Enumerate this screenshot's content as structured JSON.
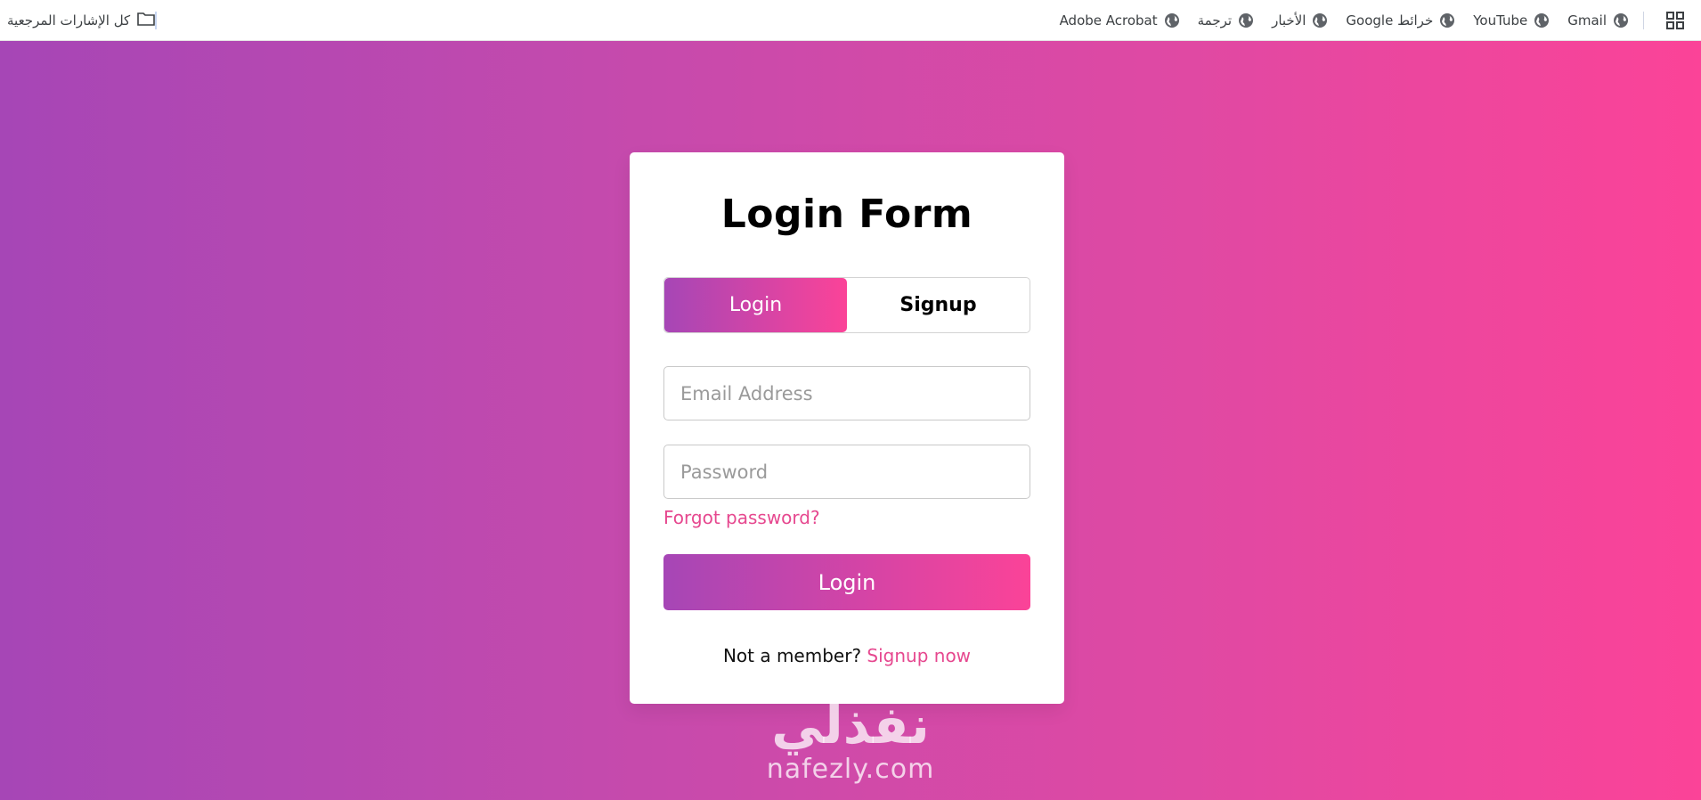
{
  "bookmarks_bar": {
    "items": [
      {
        "label": "Gmail",
        "icon": "globe-icon"
      },
      {
        "label": "YouTube",
        "icon": "globe-icon"
      },
      {
        "label": "خرائط Google",
        "icon": "globe-icon"
      },
      {
        "label": "الأخبار",
        "icon": "globe-icon"
      },
      {
        "label": "ترجمة",
        "icon": "globe-icon"
      },
      {
        "label": "Adobe Acrobat",
        "icon": "globe-icon"
      }
    ],
    "all_bookmarks_label": "كل الإشارات المرجعية",
    "apps_icon": "apps-grid-icon",
    "folder_icon": "folder-icon"
  },
  "login_form": {
    "title": "Login Form",
    "tabs": {
      "login": "Login",
      "signup": "Signup"
    },
    "email_placeholder": "Email Address",
    "password_placeholder": "Password",
    "forgot_password": "Forgot password?",
    "submit_label": "Login",
    "footer_text": "Not a member?",
    "footer_link": "Signup now"
  },
  "watermark": {
    "arabic": "نفذلي",
    "latin": "nafezly.com"
  },
  "colors": {
    "gradient_start": "#a646b6",
    "gradient_end": "#fb4398",
    "link": "#e6488f"
  }
}
